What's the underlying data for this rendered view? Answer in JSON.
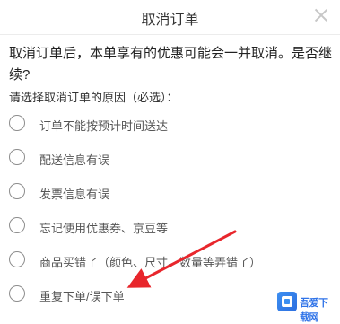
{
  "dialog": {
    "title": "取消订单",
    "close_icon": "close-icon",
    "message": "取消订单后，本单享有的优惠可能会一并取消。是否继续?",
    "hint": "请选择取消订单的原因（必选）：",
    "reasons": [
      "订单不能按预计时间送达",
      "配送信息有误",
      "发票信息有误",
      "忘记使用优惠券、京豆等",
      "商品买错了（颜色、尺寸、数量等弄错了）",
      "重复下单/误下单"
    ]
  },
  "annotation": {
    "arrow_color": "#e8262c"
  },
  "watermark": {
    "text": "吾爱下载网"
  }
}
